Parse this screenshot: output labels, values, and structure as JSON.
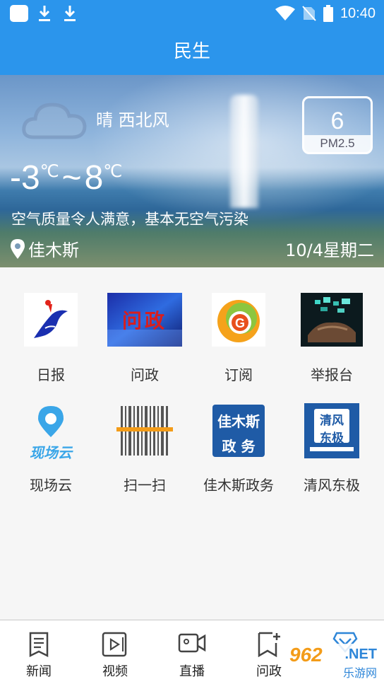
{
  "status_bar": {
    "time": "10:40"
  },
  "header": {
    "title": "民生"
  },
  "weather": {
    "condition": "晴 西北风",
    "pm_value": "6",
    "pm_label": "PM2.5",
    "temp_low": "-3",
    "temp_high": "8",
    "temp_unit": "℃",
    "temp_separator": "~",
    "air_quality": "空气质量令人满意，基本无空气污染",
    "location": "佳木斯",
    "date": "10/4星期二"
  },
  "services": [
    {
      "label": "日报",
      "icon": "daily-news-logo"
    },
    {
      "label": "问政",
      "icon": "wenzheng-logo"
    },
    {
      "label": "订阅",
      "icon": "subscribe-logo"
    },
    {
      "label": "举报台",
      "icon": "report-logo"
    },
    {
      "label": "现场云",
      "icon": "xianchangyun-logo",
      "logo_text": "现场云"
    },
    {
      "label": "扫一扫",
      "icon": "barcode-scan-icon"
    },
    {
      "label": "佳木斯政务",
      "icon": "jiamusi-gov-logo",
      "logo_lines": [
        "佳木斯",
        "政 务"
      ]
    },
    {
      "label": "清风东极",
      "icon": "qingfeng-logo",
      "logo_lines": [
        "清风",
        "东极"
      ]
    }
  ],
  "logo_texts": {
    "wenzheng": "问政"
  },
  "tabs": [
    {
      "label": "新闻",
      "icon": "news-icon"
    },
    {
      "label": "视频",
      "icon": "video-icon"
    },
    {
      "label": "直播",
      "icon": "live-camera-icon"
    },
    {
      "label": "问政",
      "icon": "ask-gov-icon"
    },
    {
      "label": "",
      "icon": "diamond-icon"
    }
  ],
  "watermark": {
    "number": "962",
    "suffix": ".NET",
    "site": "乐游网"
  },
  "colors": {
    "header_blue": "#2b95ec",
    "accent_orange": "#f39c19"
  }
}
